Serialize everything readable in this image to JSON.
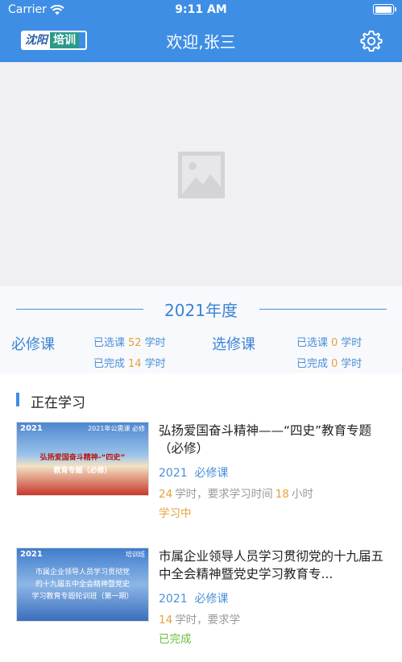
{
  "status_bar": {
    "carrier": "Carrier",
    "time": "9:11 AM",
    "battery_level": 1.0
  },
  "nav": {
    "logo_left": "沈阳",
    "logo_right": "培训",
    "title": "欢迎,张三",
    "settings_icon": "gear-icon"
  },
  "banner": {
    "icon": "image-placeholder-icon"
  },
  "year": {
    "title": "2021年度",
    "required": {
      "label": "必修课",
      "selected_prefix": "已选课",
      "selected_value": "52",
      "selected_unit": "学时",
      "done_prefix": "已完成",
      "done_value": "14",
      "done_unit": "学时"
    },
    "elective": {
      "label": "选修课",
      "selected_prefix": "已选课",
      "selected_value": "0",
      "selected_unit": "学时",
      "done_prefix": "已完成",
      "done_value": "0",
      "done_unit": "学时"
    }
  },
  "learning": {
    "title": "正在学习",
    "courses": [
      {
        "title": "弘扬爱国奋斗精神——“四史”教育专题（必修）",
        "year": "2021",
        "type": "必修课",
        "hours": "24",
        "hours_unit": "学时，要求学习时间",
        "req_hours": "18",
        "req_unit": "小时",
        "status": "学习中",
        "status_color": "#e6a23c",
        "thumb": {
          "year": "2021",
          "tag": "2021年公需课  必修",
          "line1": "弘扬爱国奋斗精神-“四史”",
          "line2": "教育专题（必修）"
        }
      },
      {
        "title": "市属企业领导人员学习贯彻党的十九届五中全会精神暨党史学习教育专...",
        "year": "2021",
        "type": "必修课",
        "hours": "14",
        "hours_unit": "学时，要求学",
        "status": "已完成",
        "status_color": "#67c23a",
        "thumb": {
          "year": "2021",
          "tag": "培训班",
          "line1": "市属企业领导人员学习贯彻党",
          "line2": "的十九届五中全会精神暨党史",
          "line3": "学习教育专题轮训班（第一期）"
        }
      }
    ]
  },
  "colors": {
    "primary": "#3e8ee5",
    "accent": "#e6a23c",
    "done": "#67c23a"
  }
}
